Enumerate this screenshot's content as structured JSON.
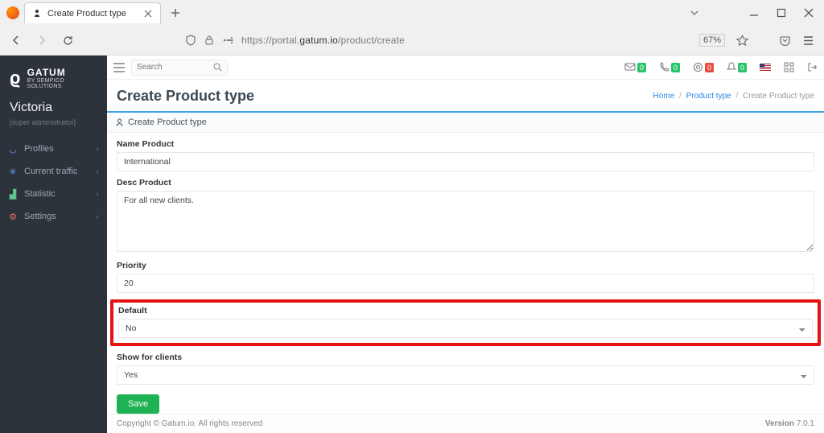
{
  "browser": {
    "tab_title": "Create Product type",
    "url_prefix": "https://portal.",
    "url_domain": "gatum.io",
    "url_path": "/product/create",
    "zoom": "67%"
  },
  "brand": {
    "name": "GATUM",
    "sub": "BY SEMPICO SOLUTIONS"
  },
  "user": {
    "name": "Victoria",
    "role": "[super administrator]"
  },
  "nav": {
    "items": [
      {
        "label": "Profiles"
      },
      {
        "label": "Current traffic"
      },
      {
        "label": "Statistic"
      },
      {
        "label": "Settings"
      }
    ]
  },
  "search": {
    "placeholder": "Search"
  },
  "topbar_badges": {
    "b1": "0",
    "b2": "0",
    "b3": "0",
    "b4": "0"
  },
  "page": {
    "title": "Create Product type",
    "breadcrumb": {
      "home": "Home",
      "parent": "Product type",
      "current": "Create Product type"
    },
    "card_title": "Create Product type"
  },
  "form": {
    "name_label": "Name Product",
    "name_value": "International",
    "desc_label": "Desc Product",
    "desc_value": "For all new clients.",
    "priority_label": "Priority",
    "priority_value": "20",
    "default_label": "Default",
    "default_value": "No",
    "show_label": "Show for clients",
    "show_value": "Yes",
    "save": "Save"
  },
  "footer": {
    "copyright": "Copyright © Gatum.io. All rights reserved",
    "version_label": "Version ",
    "version": "7.0.1"
  }
}
